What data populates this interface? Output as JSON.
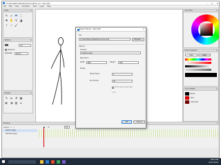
{
  "window": {
    "title": "C:\\Users\\Rachel\\Desktop\\Animation.pcl - Pencil2D",
    "controls": [
      "–",
      "□",
      "✕"
    ]
  },
  "menu": [
    "File",
    "Edit",
    "View",
    "Animation",
    "Tools",
    "Layer",
    "Help"
  ],
  "panels": {
    "tools": "Tools",
    "options": "Options",
    "display": "Display",
    "color_box": "Color Box",
    "color_inspector": "Color Inspector",
    "color_palette": "Color Palette",
    "timeline": "Timeline"
  },
  "options": {
    "size_value": "2.0",
    "pressure_label": "Pressure",
    "stabilizer_label": "Stabilizer",
    "stabilizer_value": "Strong"
  },
  "color_inspector": {
    "tabs": [
      "HSV",
      "RGB"
    ],
    "active_tab": "HSV"
  },
  "palette": {
    "colors": [
      {
        "name": "Black",
        "hex": "#000000"
      },
      {
        "name": "Red",
        "hex": "#d40000"
      },
      {
        "name": "Dark Red",
        "hex": "#700000"
      }
    ]
  },
  "dialog": {
    "title": "Export Movie - Pencil2D",
    "file_section": "File",
    "file_path": "C:/Users/Rachel/Desktop/movie.mp4",
    "browse_label": "Browse...",
    "options_section": "Options",
    "camera_label": "Camera",
    "camera_value": "Camera Layer",
    "resolution_label": "Resolution",
    "width_label": "Width",
    "width_value": "800",
    "height_label": "Height",
    "height_value": "600",
    "range_label": "Range",
    "start_frame_label": "Start Frame",
    "start_frame_value": "1",
    "end_frame_label": "End Frame",
    "end_frame_value": "30",
    "end_of_sound_label": "To the end of sound clips",
    "loop_label": "Loop",
    "ok_label": "OK",
    "cancel_label": "Cancel"
  },
  "timeline": {
    "layers_label": "Layers:",
    "layers": [
      "Vector Layer",
      "Camera Layer"
    ],
    "fps_value": "12",
    "loop_label": "Loop"
  },
  "taskbar": {
    "time": "08:07 PM",
    "date": "20-01-2019"
  },
  "colors": {
    "accent": "#2b7cd3",
    "frame_cells": "#dfe9c9",
    "taskbar": "#1f2a3a"
  }
}
